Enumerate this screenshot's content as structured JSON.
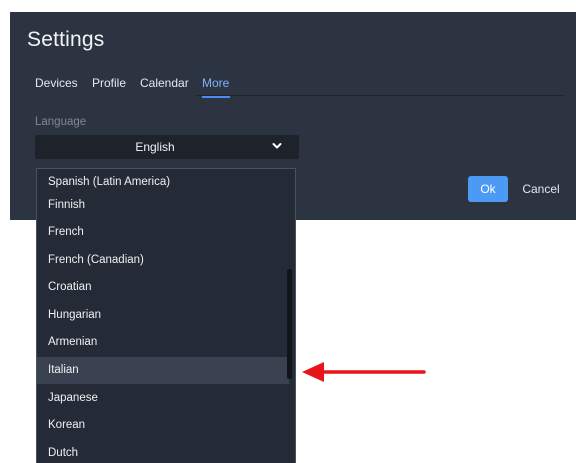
{
  "dialog": {
    "title": "Settings",
    "tabs": [
      {
        "label": "Devices",
        "active": false
      },
      {
        "label": "Profile",
        "active": false
      },
      {
        "label": "Calendar",
        "active": false
      },
      {
        "label": "More",
        "active": true
      }
    ],
    "language_label": "Language",
    "language_select": {
      "value": "English",
      "icon": "chevron-down-icon"
    },
    "buttons": {
      "ok_label": "Ok",
      "cancel_label": "Cancel"
    }
  },
  "dropdown": {
    "options": [
      "Spanish (Latin America)",
      "Finnish",
      "French",
      "French (Canadian)",
      "Croatian",
      "Hungarian",
      "Armenian",
      "Italian",
      "Japanese",
      "Korean",
      "Dutch"
    ],
    "highlighted": "Italian"
  },
  "annotation": {
    "icon": "red-arrow-icon",
    "color": "#e8141b"
  },
  "colors": {
    "dialog_bg": "#2d3441",
    "select_bg": "#1e222b",
    "accent": "#4d9af5",
    "active_tab": "#7fb1ff"
  }
}
